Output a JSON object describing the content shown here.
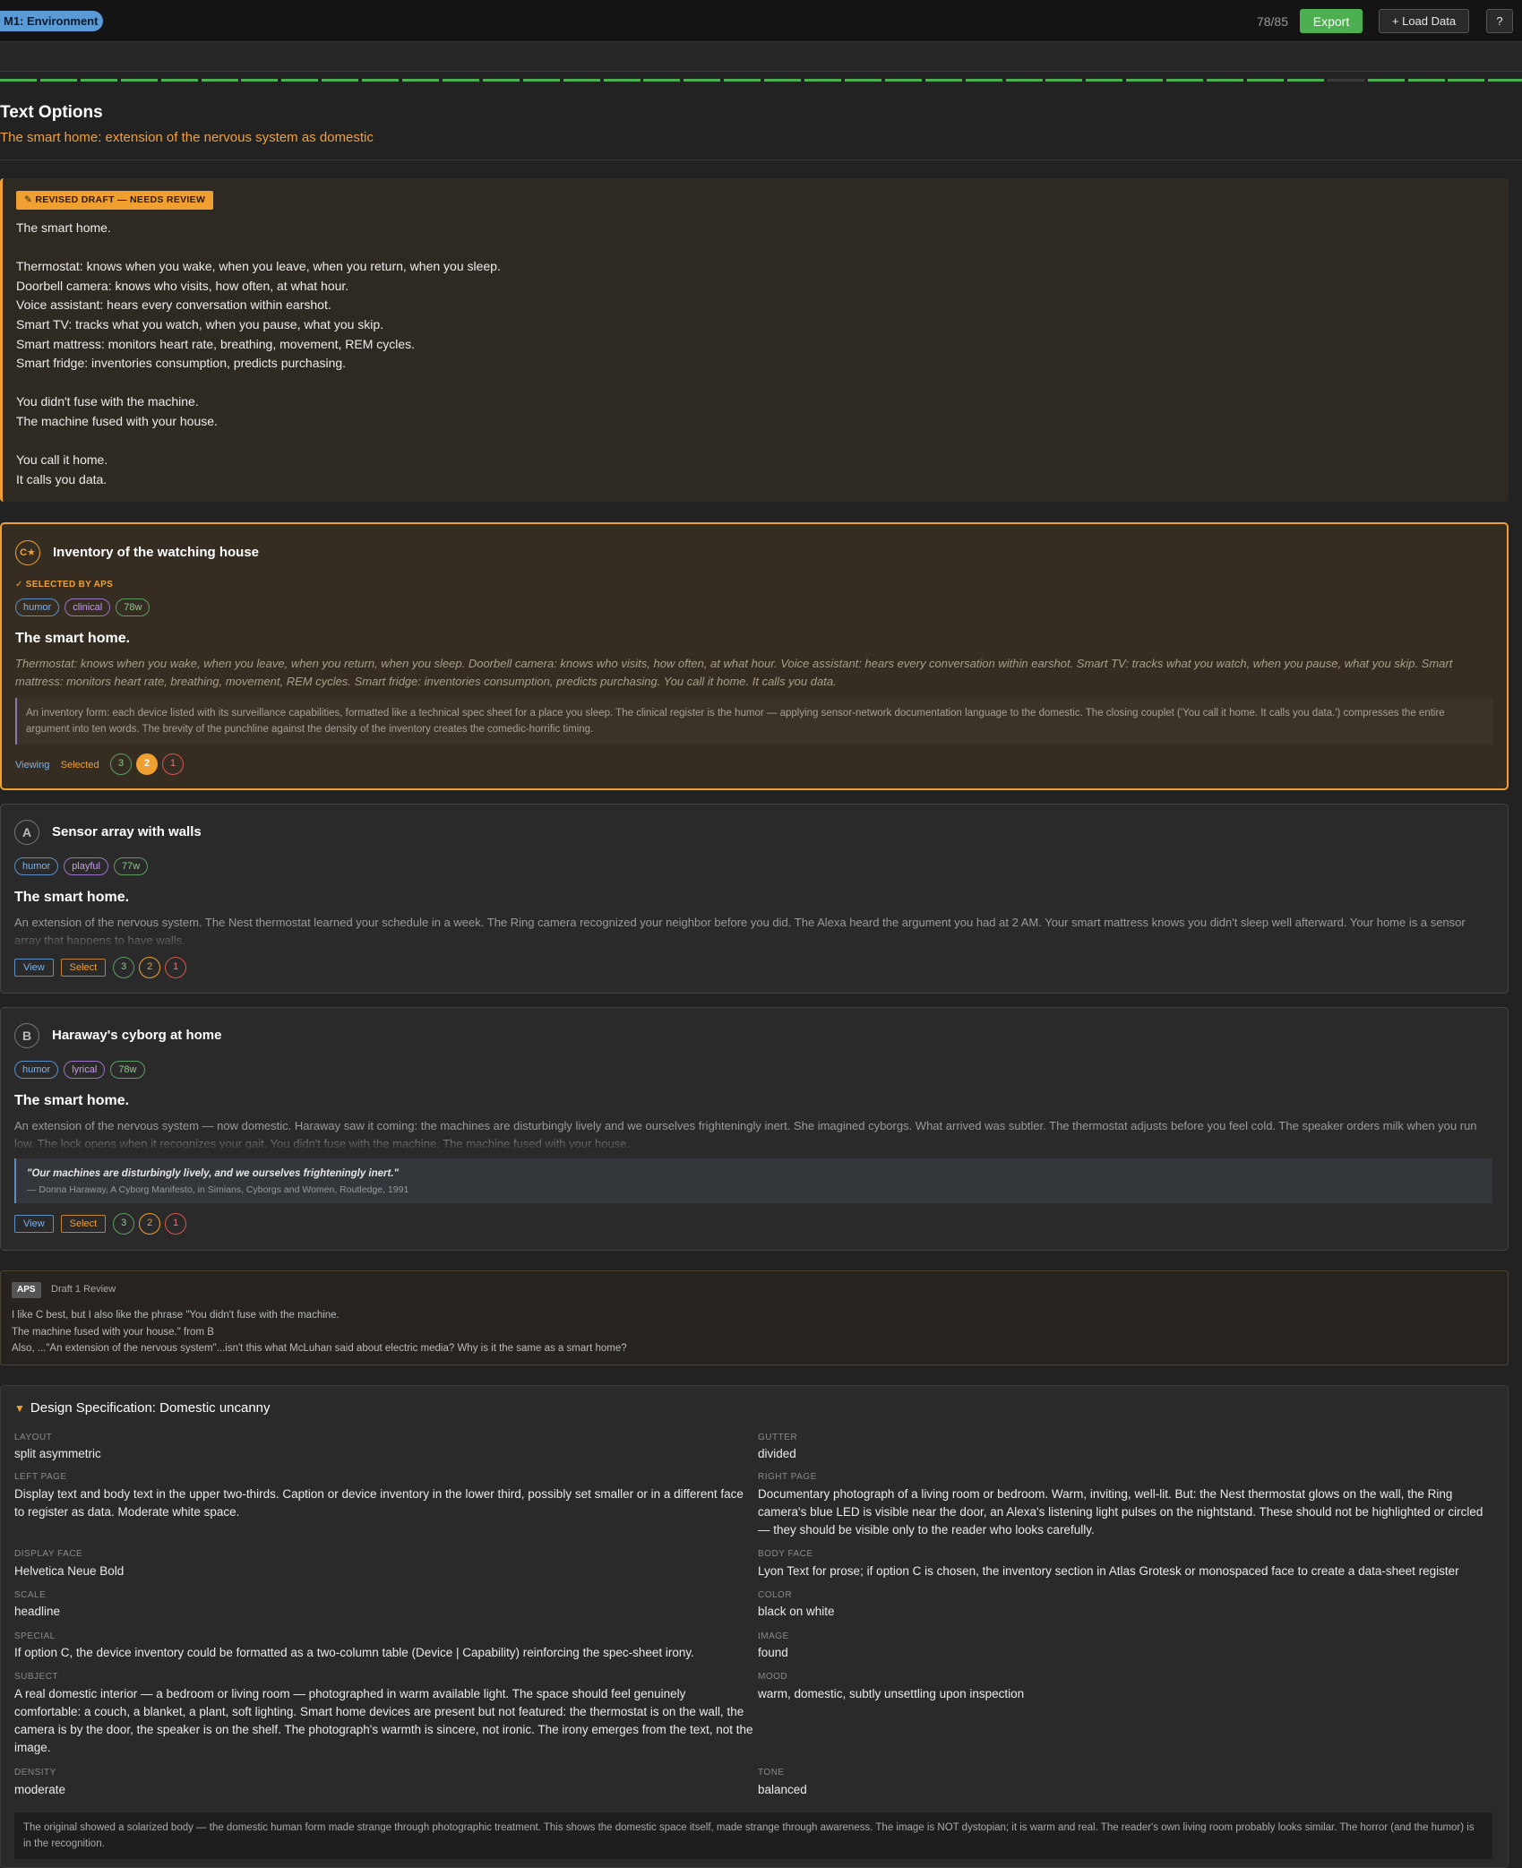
{
  "header": {
    "module": "M1: Environment",
    "counter": "78/85",
    "export_label": "Export",
    "load_label": "+ Load Data",
    "help_label": "?"
  },
  "progress": {
    "completed": 78,
    "total": 85
  },
  "page": {
    "title": "Text Options",
    "subtitle": "The smart home: extension of the nervous system as domestic"
  },
  "draft": {
    "badge": "✎ REVISED DRAFT — NEEDS REVIEW",
    "text": "The smart home.\n\nThermostat: knows when you wake, when you leave, when you return, when you sleep.\nDoorbell camera: knows who visits, how often, at what hour.\nVoice assistant: hears every conversation within earshot.\nSmart TV: tracks what you watch, when you pause, what you skip.\nSmart mattress: monitors heart rate, breathing, movement, REM cycles.\nSmart fridge: inventories consumption, predicts purchasing.\n\nYou didn't fuse with the machine.\nThe machine fused with your house.\n\nYou call it home.\nIt calls you data."
  },
  "options": [
    {
      "icon": "C★",
      "title": "Inventory of the watching house",
      "selected_by": "✓ SELECTED BY APS",
      "tags": [
        "humor",
        "clinical",
        "78w"
      ],
      "heading": "The smart home.",
      "body": "Thermostat: knows when you wake, when you leave, when you return, when you sleep. Doorbell camera: knows who visits, how often, at what hour. Voice assistant: hears every conversation within earshot. Smart TV: tracks what you watch, when you pause, what you skip. Smart mattress: monitors heart rate, breathing, movement, REM cycles. Smart fridge: inventories consumption, predicts purchasing. You call it home. It calls you data.",
      "note": "An inventory form: each device listed with its surveillance capabilities, formatted like a technical spec sheet for a place you sleep. The clinical register is the humor — applying sensor-network documentation language to the domestic. The closing couplet ('You call it home. It calls you data.') compresses the entire argument into ten words. The brevity of the punchline against the density of the inventory creates the comedic-horrific timing.",
      "viewing_label": "Viewing",
      "selected_label": "Selected",
      "ratings": [
        "3",
        "2",
        "1"
      ],
      "active_rating": 2
    },
    {
      "icon": "A",
      "title": "Sensor array with walls",
      "tags": [
        "humor",
        "playful",
        "77w"
      ],
      "heading": "The smart home.",
      "body": "An extension of the nervous system. The Nest thermostat learned your schedule in a week. The Ring camera recognized your neighbor before you did. The Alexa heard the argument you had at 2 AM. Your smart mattress knows you didn't sleep well afterward. Your home is a sensor array that happens to have walls.",
      "view_label": "View",
      "select_label": "Select",
      "ratings": [
        "3",
        "2",
        "1"
      ]
    },
    {
      "icon": "B",
      "title": "Haraway's cyborg at home",
      "tags": [
        "humor",
        "lyrical",
        "78w"
      ],
      "heading": "The smart home.",
      "body": "An extension of the nervous system — now domestic. Haraway saw it coming: the machines are disturbingly lively and we ourselves frighteningly inert. She imagined cyborgs. What arrived was subtler. The thermostat adjusts before you feel cold. The speaker orders milk when you run low. The lock opens when it recognizes your gait. You didn't fuse with the machine. The machine fused with your house.",
      "quote": "\"Our machines are disturbingly lively, and we ourselves frighteningly inert.\"",
      "quote_source": "— Donna Haraway, A Cyborg Manifesto, in Simians, Cyborgs and Women, Routledge, 1991",
      "view_label": "View",
      "select_label": "Select",
      "ratings": [
        "3",
        "2",
        "1"
      ]
    }
  ],
  "review": {
    "badge": "APS",
    "label": "Draft 1 Review",
    "text": "I like C best, but I also like the phrase \"You didn't fuse with the machine.\nThe machine fused with your house.\" from B\nAlso, ...\"An extension of the nervous system\"...isn't this what McLuhan said about electric media? Why is it the same as a smart home?"
  },
  "spec": {
    "title": "Design Specification: Domestic uncanny",
    "fields": [
      {
        "label": "LAYOUT",
        "value": "split asymmetric"
      },
      {
        "label": "GUTTER",
        "value": "divided"
      },
      {
        "label": "LEFT PAGE",
        "value": "Display text and body text in the upper two-thirds. Caption or device inventory in the lower third, possibly set smaller or in a different face to register as data. Moderate white space."
      },
      {
        "label": "RIGHT PAGE",
        "value": "Documentary photograph of a living room or bedroom. Warm, inviting, well-lit. But: the Nest thermostat glows on the wall, the Ring camera's blue LED is visible near the door, an Alexa's listening light pulses on the nightstand. These should not be highlighted or circled — they should be visible only to the reader who looks carefully."
      },
      {
        "label": "DISPLAY FACE",
        "value": "Helvetica Neue Bold"
      },
      {
        "label": "BODY FACE",
        "value": "Lyon Text for prose; if option C is chosen, the inventory section in Atlas Grotesk or monospaced face to create a data-sheet register"
      },
      {
        "label": "SCALE",
        "value": "headline"
      },
      {
        "label": "COLOR",
        "value": "black on white"
      },
      {
        "label": "SPECIAL",
        "value": "If option C, the device inventory could be formatted as a two-column table (Device | Capability) reinforcing the spec-sheet irony."
      },
      {
        "label": "IMAGE",
        "value": "found"
      },
      {
        "label": "SUBJECT",
        "value": "A real domestic interior — a bedroom or living room — photographed in warm available light. The space should feel genuinely comfortable: a couch, a blanket, a plant, soft lighting. Smart home devices are present but not featured: the thermostat is on the wall, the camera is by the door, the speaker is on the shelf. The photograph's warmth is sincere, not ironic. The irony emerges from the text, not the image."
      },
      {
        "label": "MOOD",
        "value": "warm, domestic, subtly unsettling upon inspection"
      },
      {
        "label": "DENSITY",
        "value": "moderate"
      },
      {
        "label": "TONE",
        "value": "balanced"
      }
    ],
    "note": "The original showed a solarized body — the domestic human form made strange through photographic treatment. This shows the domestic space itself, made strange through awareness. The image is NOT dystopian; it is warm and real. The reader's own living room probably looks similar. The horror (and the humor) is in the recognition."
  }
}
